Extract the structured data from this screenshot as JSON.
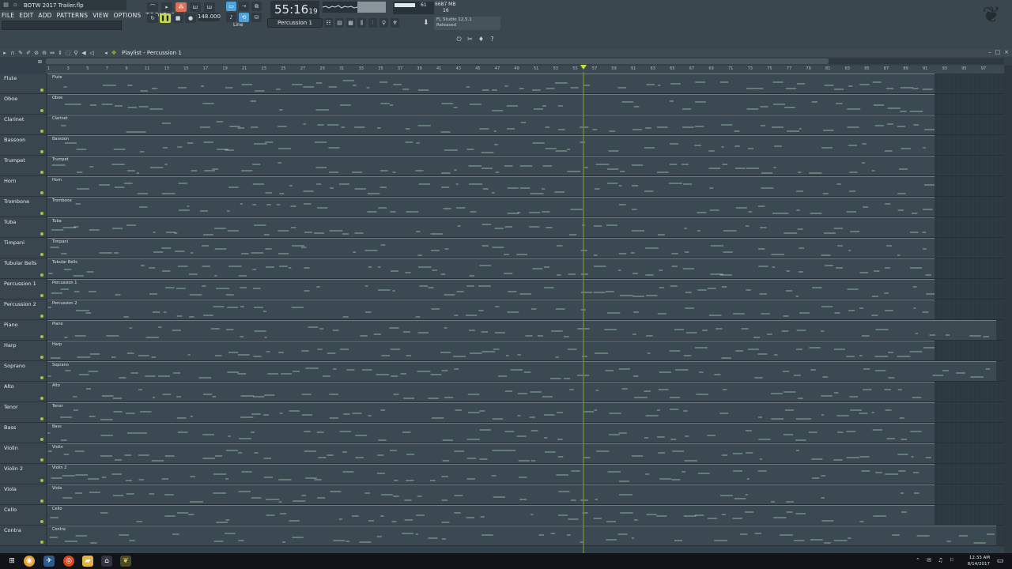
{
  "window": {
    "title": "BOTW 2017 Trailer.flp"
  },
  "menu": [
    "FILE",
    "EDIT",
    "ADD",
    "PATTERNS",
    "VIEW",
    "OPTIONS",
    "TOOLS",
    "?"
  ],
  "transport": {
    "tempo": "148.000",
    "time_main": "55:16",
    "time_frac": "19",
    "cpu_value": "61",
    "memory": "6687 MB",
    "memory_sub": "16"
  },
  "pattern_selector": {
    "selected": "Percussion 1"
  },
  "snap": {
    "label": "Line"
  },
  "news": {
    "line1": "FL Studio 12.5.1",
    "line2": "Released"
  },
  "playlist": {
    "title": "Playlist - Percussion 1",
    "ruler_ticks": [
      "1",
      "3",
      "5",
      "7",
      "9",
      "11",
      "13",
      "15",
      "17",
      "19",
      "21",
      "23",
      "25",
      "27",
      "29",
      "31",
      "33",
      "35",
      "37",
      "39",
      "41",
      "43",
      "45",
      "47",
      "49",
      "51",
      "53",
      "55",
      "57",
      "59",
      "61",
      "63",
      "65",
      "67",
      "69",
      "71",
      "73",
      "75",
      "77",
      "79",
      "81",
      "83",
      "85",
      "87",
      "89",
      "91",
      "93",
      "95",
      "97"
    ],
    "tracks": [
      {
        "name": "Flute"
      },
      {
        "name": "Oboe"
      },
      {
        "name": "Clarinet"
      },
      {
        "name": "Bassoon"
      },
      {
        "name": "Trumpet"
      },
      {
        "name": "Horn"
      },
      {
        "name": "Trombone"
      },
      {
        "name": "Tuba"
      },
      {
        "name": "Timpani"
      },
      {
        "name": "Tubular Bells"
      },
      {
        "name": "Percussion 1"
      },
      {
        "name": "Percussion 2"
      },
      {
        "name": "Piano"
      },
      {
        "name": "Harp"
      },
      {
        "name": "Soprano"
      },
      {
        "name": "Alto"
      },
      {
        "name": "Tenor"
      },
      {
        "name": "Bass"
      },
      {
        "name": "Violin"
      },
      {
        "name": "Violin 2"
      },
      {
        "name": "Viola"
      },
      {
        "name": "Cello"
      },
      {
        "name": "Contra"
      }
    ]
  },
  "taskbar": {
    "time": "12:33 AM",
    "date": "8/14/2017"
  },
  "colors": {
    "accent_green": "#c6e13f",
    "lane_bg": "#2e3a41",
    "clip_bg": "#3b4a52",
    "note": "#9bb8a9"
  }
}
